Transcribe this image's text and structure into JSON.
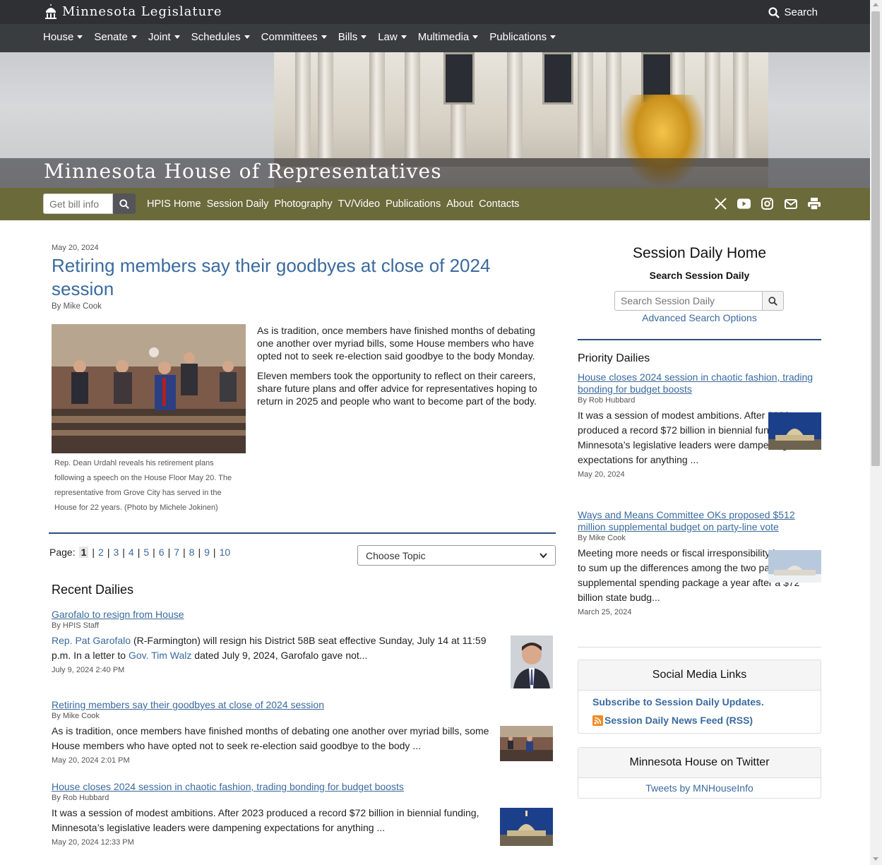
{
  "topbar": {
    "brand": "Minnesota Legislature",
    "search_label": "Search"
  },
  "nav": [
    "House",
    "Senate",
    "Joint",
    "Schedules",
    "Committees",
    "Bills",
    "Law",
    "Multimedia",
    "Publications"
  ],
  "hero": {
    "title": "Minnesota House of Representatives"
  },
  "subnav": {
    "bill_placeholder": "Get bill info",
    "links": [
      "HPIS Home",
      "Session Daily",
      "Photography",
      "TV/Video",
      "Publications",
      "About",
      "Contacts"
    ]
  },
  "article": {
    "date": "May 20, 2024",
    "title": "Retiring members say their goodbyes at close of 2024 session",
    "byline": "By Mike Cook",
    "paragraphs": [
      "As is tradition, once members have finished months of debating one another over myriad bills, some House members who have opted not to seek re-election said goodbye to the body Monday.",
      "Eleven members took the opportunity to reflect on their careers, share future plans and offer advice for representatives hoping to return in 2025 and people who want to become part of the body."
    ],
    "caption": "Rep. Dean Urdahl reveals his retirement plans following a speech on the House Floor May 20. The representative from Grove City has served in the House for 22 years. (Photo by Michele Jokinen)"
  },
  "pager": {
    "label": "Page:",
    "pages": [
      "1",
      "2",
      "3",
      "4",
      "5",
      "6",
      "7",
      "8",
      "9",
      "10"
    ],
    "current": "1"
  },
  "topic_select": "Choose Topic",
  "recent": {
    "heading": "Recent Dailies",
    "items": [
      {
        "title": "Garofalo to resign from House",
        "byline": "By HPIS Staff",
        "link1": "Rep. Pat Garofalo",
        "text1": " (R-Farmington) will resign his District 58B seat effective Sunday, July 14 at 11:59 p.m. In a letter to ",
        "link2": "Gov. Tim Walz",
        "text2": " dated July 9, 2024, Garofalo gave not...",
        "date": "July 9, 2024 2:40 PM"
      },
      {
        "title": "Retiring members say their goodbyes at close of 2024 session",
        "byline": "By Mike Cook",
        "text": "As is tradition, once members have finished months of debating one another over myriad bills, some House members who have opted not to seek re-election said goodbye to the body ...",
        "date": "May 20, 2024 2:01 PM"
      },
      {
        "title": "House closes 2024 session in chaotic fashion, trading bonding for budget boosts",
        "byline": "By Rob Hubbard",
        "text": "It was a session of modest ambitions. After 2023 produced a record $72 billion in biennial funding, Minnesota’s legislative leaders were dampening expectations for anything ...",
        "date": "May 20, 2024 12:33 PM"
      }
    ]
  },
  "sidebar": {
    "heading": "Session Daily Home",
    "search_heading": "Search Session Daily",
    "search_placeholder": "Search Session Daily",
    "advanced": "Advanced Search Options",
    "priority_heading": "Priority Dailies",
    "priority": [
      {
        "title": "House closes 2024 session in chaotic fashion, trading bonding for budget boosts",
        "byline": "By Rob Hubbard",
        "text": "It was a session of modest ambitions. After 2023 produced a record $72 billion in biennial funding, Minnesota’s legislative leaders were dampening expectations for anything ...",
        "date": "May 20, 2024"
      },
      {
        "title": "Ways and Means Committee OKs proposed $512 million supplemental budget on party-line vote",
        "byline": "By Mike Cook",
        "text": "Meeting more needs or fiscal irresponsibility is one way to sum up the differences among the two parties on a supplemental spending package a year after a $72 billion state budg...",
        "date": "March 25, 2024"
      }
    ],
    "social_heading": "Social Media Links",
    "subscribe": "Subscribe to Session Daily Updates.",
    "rss": "Session Daily News Feed (RSS)",
    "twitter_heading": "Minnesota House on Twitter",
    "tweets": "Tweets by MNHouseInfo"
  },
  "colors": {
    "topbar": "#2e3033",
    "navbar": "#3a3d40",
    "subnav": "#6b6a3b",
    "link": "#3a6a9e",
    "rule": "#2d4f7a"
  }
}
